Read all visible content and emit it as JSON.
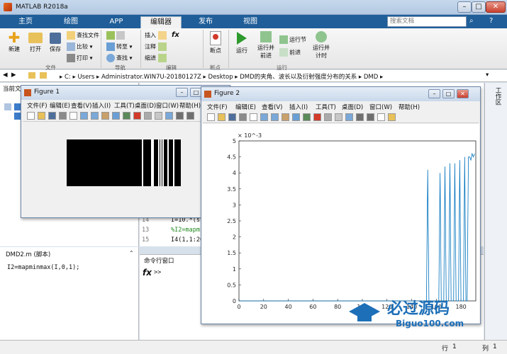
{
  "app": {
    "title": "MATLAB R2018a"
  },
  "tabs": [
    "主页",
    "绘图",
    "APP",
    "编辑器",
    "发布",
    "视图"
  ],
  "search_placeholder": "搜索文档",
  "ribbon": {
    "file": {
      "new": "新建",
      "open": "打开",
      "save": "保存",
      "find_files": "查找文件",
      "compare": "比较",
      "print": "打印",
      "group": "文件"
    },
    "nav": {
      "goto": "转至",
      "find": "查找",
      "group": "导航"
    },
    "edit": {
      "insert": "插入",
      "comment": "注释",
      "indent": "缩进",
      "fx": "fx",
      "group": "编辑"
    },
    "breakpoints": {
      "label": "断点",
      "group": "断点"
    },
    "run": {
      "run": "运行",
      "run_advance": "运行并\n前进",
      "run_section": "运行节",
      "advance": "前进",
      "run_time": "运行并\n计时",
      "group": "运行"
    }
  },
  "address": [
    "C:",
    "Users",
    "Administrator.WIN7U-20180127Z",
    "Desktop",
    "DMD的夹角、波长以及衍射强度分布的关系",
    "DMD"
  ],
  "left_pane": {
    "title": "当前文件"
  },
  "editor": {
    "lines": [
      {
        "num": "14",
        "code": "I=10.*(s"
      },
      {
        "num": "13",
        "code": "%I2=mapm"
      },
      {
        "num": "15",
        "code": "I4(1,1:20"
      }
    ]
  },
  "script_pane": {
    "title": "DMD2.m  (脚本)",
    "code": "I2=mapminmax(I,0,1);"
  },
  "cmd": {
    "title": "命令行窗口",
    "prompt": ">>"
  },
  "right_strip": {
    "label": "工作区"
  },
  "status": {
    "row_label": "行",
    "row": "1",
    "col_label": "列",
    "col": "1"
  },
  "figure1": {
    "title": "Figure 1",
    "menu": [
      "文件(F)",
      "编辑(E)",
      "查看(V)",
      "插入(I)",
      "工具(T)",
      "桌面(D)",
      "窗口(W)",
      "帮助(H)"
    ],
    "white_stripes": [
      0.66,
      0.74,
      0.75,
      0.8,
      0.82,
      0.84,
      0.88,
      0.93
    ]
  },
  "figure2": {
    "title": "Figure 2",
    "menu": [
      "文件(F)",
      "编辑(E)",
      "查看(V)",
      "插入(I)",
      "工具(T)",
      "桌面(D)",
      "窗口(W)",
      "帮助(H)"
    ]
  },
  "watermark": {
    "name": "必过源码",
    "url": "Biguo100.com"
  },
  "chart_data": {
    "type": "line",
    "title": "",
    "xlabel": "",
    "ylabel": "",
    "exponent_label": "× 10^-3",
    "xlim": [
      0,
      192
    ],
    "ylim": [
      0,
      5
    ],
    "xticks": [
      0,
      20,
      40,
      60,
      80,
      100,
      120,
      140,
      160,
      180
    ],
    "yticks": [
      0,
      0.5,
      1,
      1.5,
      2,
      2.5,
      3,
      3.5,
      4,
      4.5,
      5
    ],
    "series": [
      {
        "x": [
          0,
          152,
          153,
          154,
          155,
          162,
          163,
          164,
          166,
          167,
          168,
          170,
          171,
          172,
          174,
          175,
          176,
          178,
          179,
          180,
          182,
          183,
          184,
          185,
          186,
          187,
          188,
          189,
          190,
          191
        ],
        "y": [
          0,
          0,
          4.1,
          0,
          0,
          0,
          4.0,
          0,
          0,
          4.2,
          0,
          0,
          4.3,
          0,
          0,
          4.3,
          0,
          0,
          4.4,
          0,
          0,
          4.5,
          0,
          0,
          4.5,
          4.5,
          4.4,
          4.6,
          4.5,
          4.6
        ]
      }
    ]
  }
}
